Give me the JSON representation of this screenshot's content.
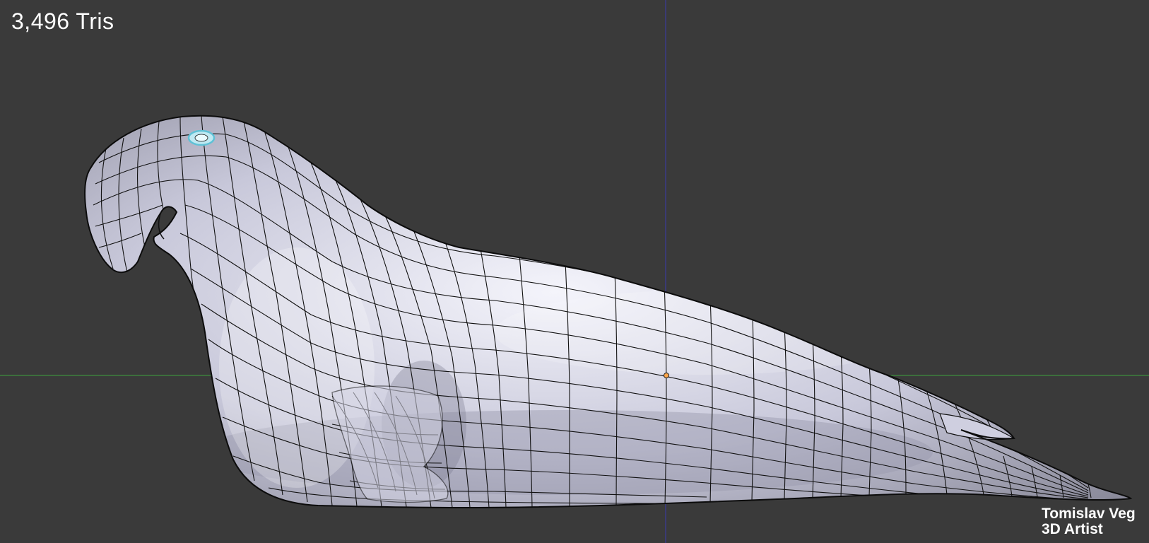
{
  "viewport": {
    "tris_label": "3,496 Tris",
    "credit_name": "Tomislav Veg",
    "credit_role": "3D Artist",
    "background_color": "#3a3a3a",
    "axis_colors": {
      "x_axis": "#3f8f3f",
      "y_axis": "#3a3a9a"
    },
    "mesh_color": "#c9c9dc",
    "wire_color": "#101010",
    "origin_marker_color": "#ffa64a",
    "selected_face_color": "#7fd0e0"
  }
}
